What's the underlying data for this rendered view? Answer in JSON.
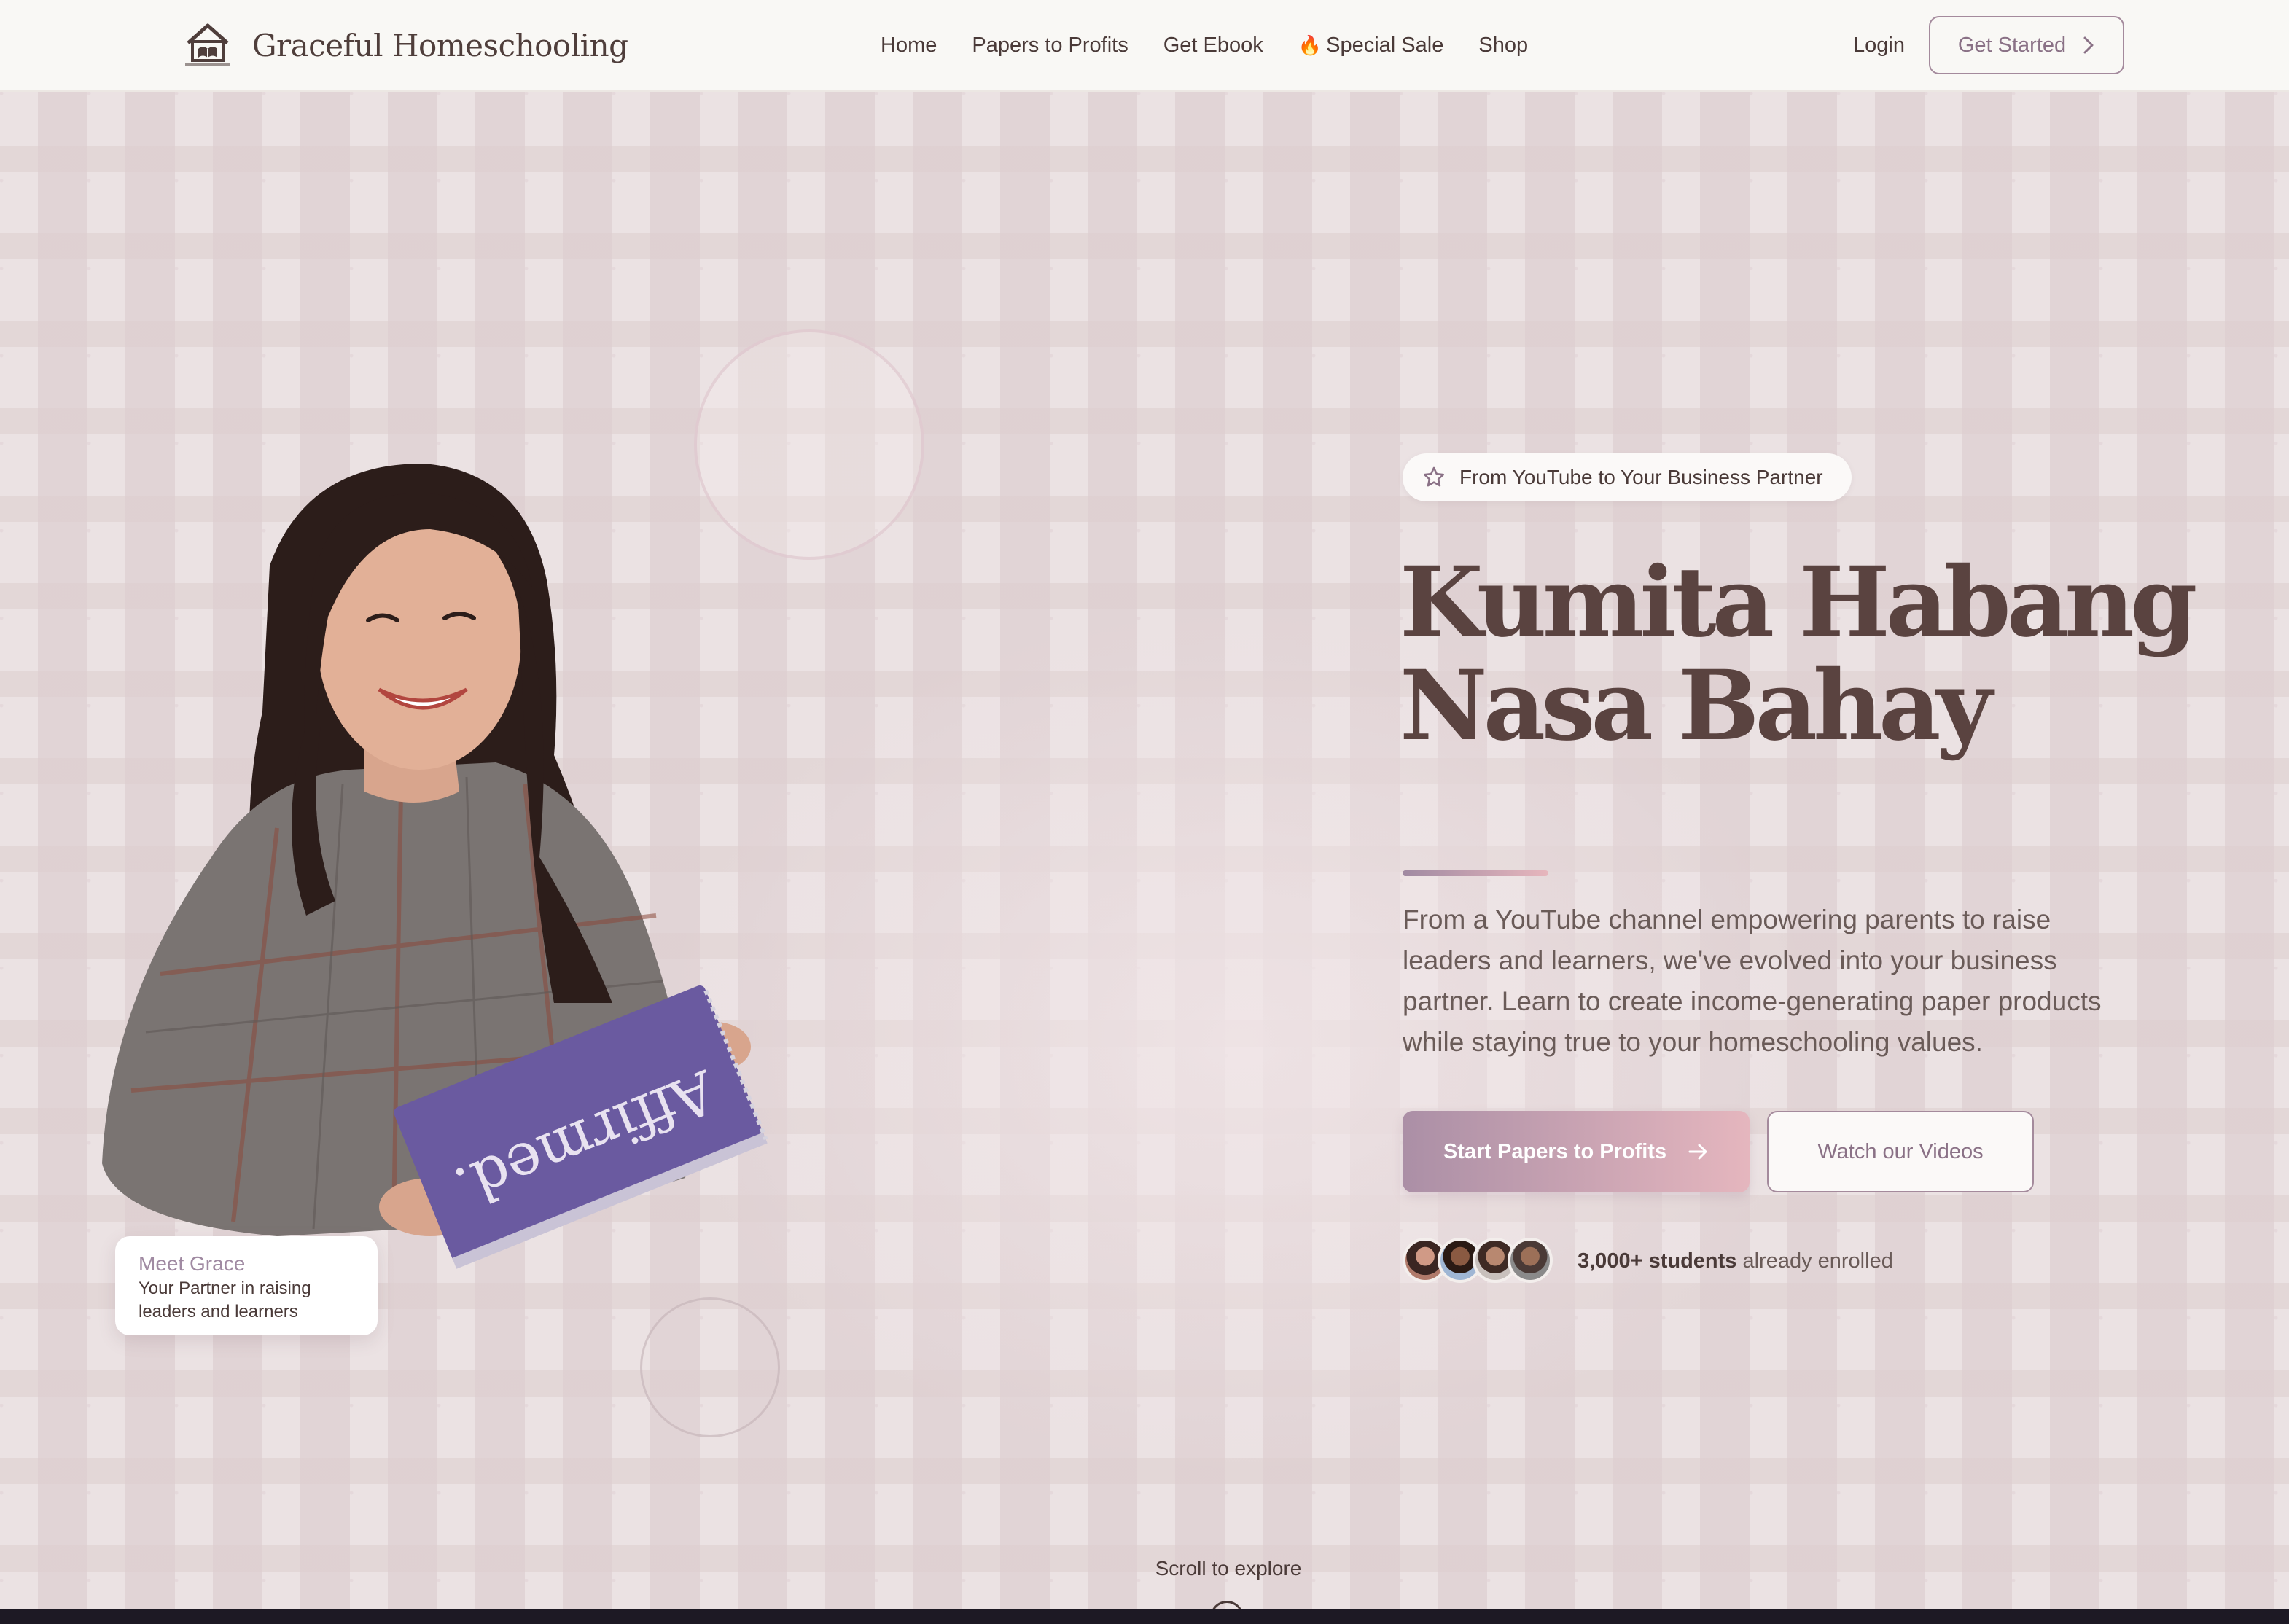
{
  "header": {
    "brand_name": "Graceful Homeschooling",
    "nav": [
      {
        "label": "Home"
      },
      {
        "label": "Papers to Profits"
      },
      {
        "label": "Get Ebook"
      },
      {
        "label": "Special Sale",
        "icon": "fire-icon",
        "icon_glyph": "🔥"
      },
      {
        "label": "Shop"
      }
    ],
    "login_label": "Login",
    "get_started_label": "Get Started"
  },
  "hero": {
    "tagline": "From YouTube to Your Business Partner",
    "headline_line1": "Kumita Habang",
    "headline_line2": "Nasa Bahay",
    "lede": "From a YouTube channel empowering parents to raise leaders and learners, we've evolved into your business partner. Learn to create income-generating paper products while staying true to your homeschooling values.",
    "primary_cta": "Start Papers to Profits",
    "secondary_cta": "Watch our Videos",
    "enrolled_count": "3,000+ students",
    "enrolled_suffix": " already enrolled",
    "meet_card": {
      "title": "Meet Grace",
      "subtitle": "Your Partner in raising leaders and learners"
    },
    "notebook_text": "Affirmed.",
    "scroll_hint": "Scroll to explore"
  },
  "colors": {
    "accent": "#a08aa2",
    "accent_pink": "#e5b6be",
    "text_dark": "#4a3a38",
    "header_bg": "#f9f8f5",
    "hero_bg": "#f1ebe9"
  }
}
